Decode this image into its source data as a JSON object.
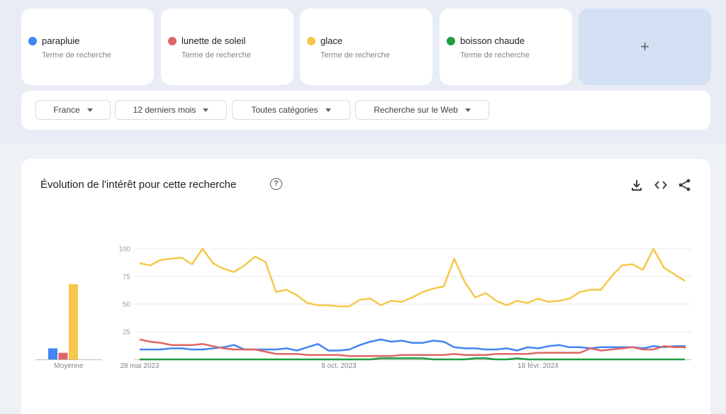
{
  "terms": [
    {
      "label": "parapluie",
      "sublabel": "Terme de recherche",
      "color": "#4285f4"
    },
    {
      "label": "lunette de soleil",
      "sublabel": "Terme de recherche",
      "color": "#e06666"
    },
    {
      "label": "glace",
      "sublabel": "Terme de recherche",
      "color": "#f6c74a"
    },
    {
      "label": "boisson chaude",
      "sublabel": "Terme de recherche",
      "color": "#1e9e3f"
    }
  ],
  "add_term_label": "+",
  "filters": [
    {
      "label": "France"
    },
    {
      "label": "12 derniers mois"
    },
    {
      "label": "Toutes catégories"
    },
    {
      "label": "Recherche sur le Web"
    }
  ],
  "chart_section": {
    "title": "Évolution de l'intérêt pour cette recherche",
    "help_label": "?",
    "actions": [
      "download-icon",
      "embed-code-icon",
      "share-icon"
    ]
  },
  "chart_data": [
    {
      "type": "bar",
      "title": "",
      "categories": [
        "Moyenne"
      ],
      "series": [
        {
          "name": "parapluie",
          "values": [
            10
          ]
        },
        {
          "name": "lunette de soleil",
          "values": [
            6
          ]
        },
        {
          "name": "glace",
          "values": [
            68
          ]
        },
        {
          "name": "boisson chaude",
          "values": [
            0
          ]
        }
      ],
      "xlabel": "Moyenne",
      "ylim": [
        0,
        100
      ]
    },
    {
      "type": "line",
      "title": "",
      "xlabel": "",
      "ylabel": "",
      "ylim": [
        0,
        100
      ],
      "yticks": [
        25,
        50,
        75,
        100
      ],
      "xtick_labels": [
        {
          "index": 0,
          "label": "28 mai 2023"
        },
        {
          "index": 19,
          "label": "8 oct. 2023"
        },
        {
          "index": 38,
          "label": "18 févr. 2024"
        }
      ],
      "grid": true,
      "series": [
        {
          "name": "glace",
          "color": "#f6c74a",
          "values": [
            87,
            85,
            90,
            91,
            92,
            86,
            100,
            87,
            82,
            79,
            85,
            93,
            88,
            61,
            63,
            58,
            51,
            49,
            49,
            48,
            48,
            54,
            55,
            49,
            53,
            52,
            56,
            61,
            64,
            66,
            91,
            70,
            56,
            60,
            53,
            49,
            53,
            51,
            55,
            52,
            53,
            55,
            61,
            63,
            63,
            75,
            85,
            86,
            81,
            100,
            83,
            77,
            71
          ]
        },
        {
          "name": "lunette de soleil",
          "color": "#e06666",
          "values": [
            18,
            16,
            15,
            13,
            13,
            13,
            14,
            12,
            10,
            9,
            9,
            9,
            7,
            5,
            5,
            5,
            4,
            4,
            4,
            4,
            3,
            3,
            3,
            3,
            3,
            4,
            4,
            4,
            4,
            4,
            5,
            4,
            4,
            4,
            5,
            5,
            5,
            5,
            6,
            6,
            6,
            6,
            6,
            10,
            8,
            9,
            10,
            11,
            9,
            9,
            12,
            11,
            11,
            10
          ]
        },
        {
          "name": "parapluie",
          "color": "#4285f4",
          "values": [
            9,
            9,
            9,
            10,
            10,
            9,
            9,
            10,
            11,
            13,
            9,
            9,
            9,
            9,
            10,
            8,
            11,
            14,
            8,
            8,
            9,
            13,
            16,
            18,
            16,
            17,
            15,
            15,
            17,
            16,
            11,
            10,
            10,
            9,
            9,
            10,
            8,
            11,
            10,
            12,
            13,
            11,
            11,
            10,
            11,
            11,
            11,
            11,
            10,
            12,
            11,
            12,
            12,
            11
          ]
        },
        {
          "name": "boisson chaude",
          "color": "#1e9e3f",
          "values": [
            0,
            0,
            0,
            0,
            0,
            0,
            0,
            0,
            0,
            0,
            0,
            0,
            0,
            0,
            0,
            0,
            0,
            0,
            0,
            0,
            0,
            0,
            0,
            1,
            1,
            1,
            1,
            1,
            0,
            0,
            0,
            0,
            1,
            1,
            0,
            0,
            1,
            0,
            0,
            0,
            0,
            0,
            0,
            0,
            0,
            0,
            0,
            0,
            0,
            0,
            0,
            0,
            0,
            0
          ]
        }
      ]
    }
  ]
}
